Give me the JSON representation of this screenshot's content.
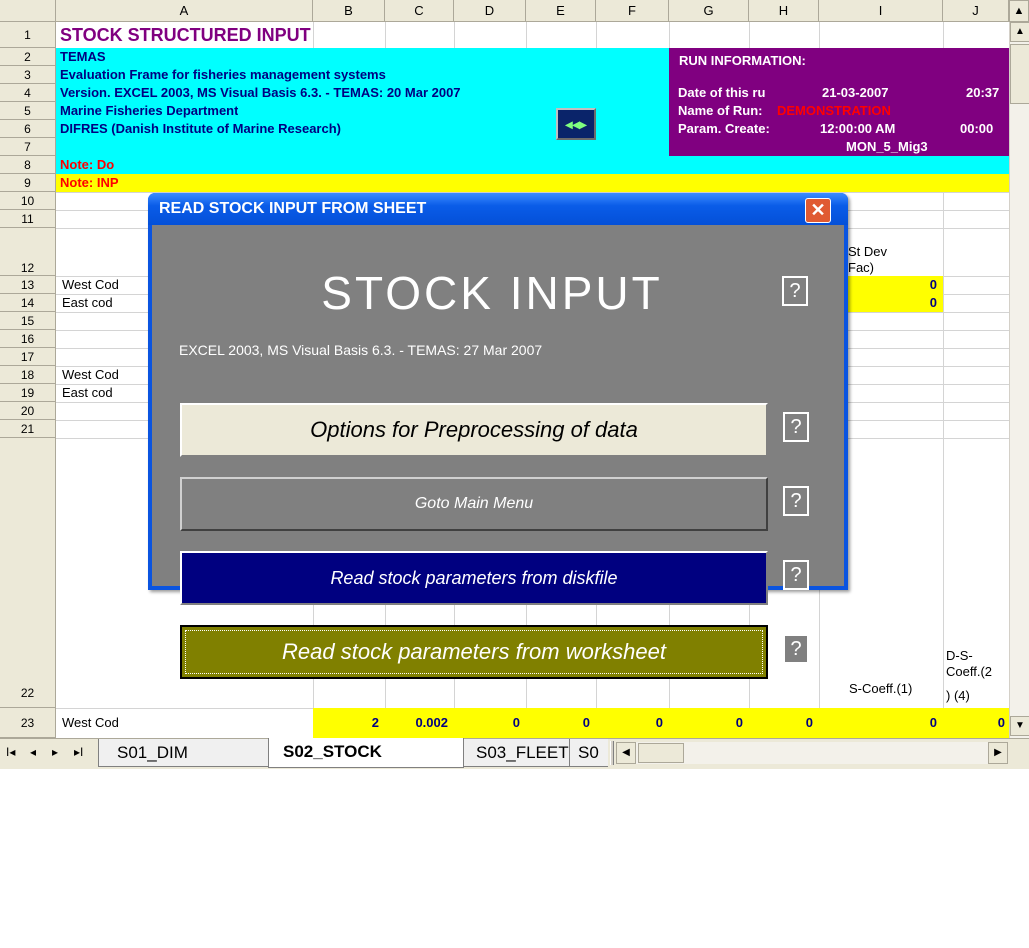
{
  "columns": [
    "A",
    "B",
    "C",
    "D",
    "E",
    "F",
    "G",
    "H",
    "I",
    "J"
  ],
  "rows": [
    "1",
    "2",
    "3",
    "4",
    "5",
    "6",
    "7",
    "8",
    "9",
    "10",
    "11",
    "12",
    "13",
    "14",
    "15",
    "16",
    "17",
    "18",
    "19",
    "20",
    "21",
    "22",
    "23"
  ],
  "sheet": {
    "title": "STOCK STRUCTURED INPUT",
    "temas": "TEMAS",
    "eval_frame": "Evaluation Frame for fisheries management systems",
    "version": "Version. EXCEL 2003, MS Visual Basis 6.3. - TEMAS: 20 Mar 2007",
    "dept": "Marine Fisheries Department",
    "difres": "DIFRES (Danish Institute of Marine Research)",
    "note1": "Note: Do",
    "note2": "Note: INP",
    "run_info": "RUN INFORMATION:",
    "date_label": "Date of this ru",
    "date_value": "21-03-2007",
    "time_value": "20:37",
    "name_label": "Name of Run:",
    "name_value": "DEMONSTRATION",
    "param_label": "Param. Create:",
    "param_value": "12:00:00 AM",
    "param_value2": "00:00",
    "mig_value": "MON_5_Mig3",
    "st_dev_1": "St Dev",
    "st_dev_2": "Fac)",
    "r13_name": "West Cod",
    "r14_name": "East cod",
    "r13_val": "0",
    "r14_val": "0",
    "r18_name": "West Cod",
    "r19_name": "East cod",
    "r22_i": "S-Coeff.(1)",
    "r22_j1": "D-S-",
    "r22_j2": "Coeff.(2",
    "r22_j3": ") (4)",
    "r23_name": "West Cod",
    "r23_b": "2",
    "r23_c": "0.002",
    "r23_d": "0",
    "r23_e": "0",
    "r23_f": "0",
    "r23_g": "0",
    "r23_h": "0",
    "r23_i": "0",
    "r23_j": "0"
  },
  "dialog": {
    "title": "READ STOCK INPUT FROM SHEET",
    "close": "✕",
    "heading": "STOCK INPUT",
    "subtitle": "EXCEL 2003, MS Visual Basis 6.3. - TEMAS: 27 Mar 2007",
    "btn_preprocess": "Options for Preprocessing of data",
    "btn_main_menu": "Goto Main Menu",
    "btn_read_disk": "Read  stock parameters from diskfile",
    "btn_read_ws": "Read stock parameters from worksheet",
    "help": "?"
  },
  "tabs": {
    "nav_first": "I◂",
    "nav_prev": "◂",
    "nav_next": "▸",
    "nav_last": "▸I",
    "tab1": "S01_DIM",
    "tab2": "S02_STOCK",
    "tab3": "S03_FLEET",
    "tab4": "S0"
  },
  "colors": {
    "purple": "#800080",
    "cyan": "#00ffff",
    "yellow": "#ffff00",
    "navy": "#000080",
    "olive": "#808000",
    "red": "#ff0000"
  }
}
